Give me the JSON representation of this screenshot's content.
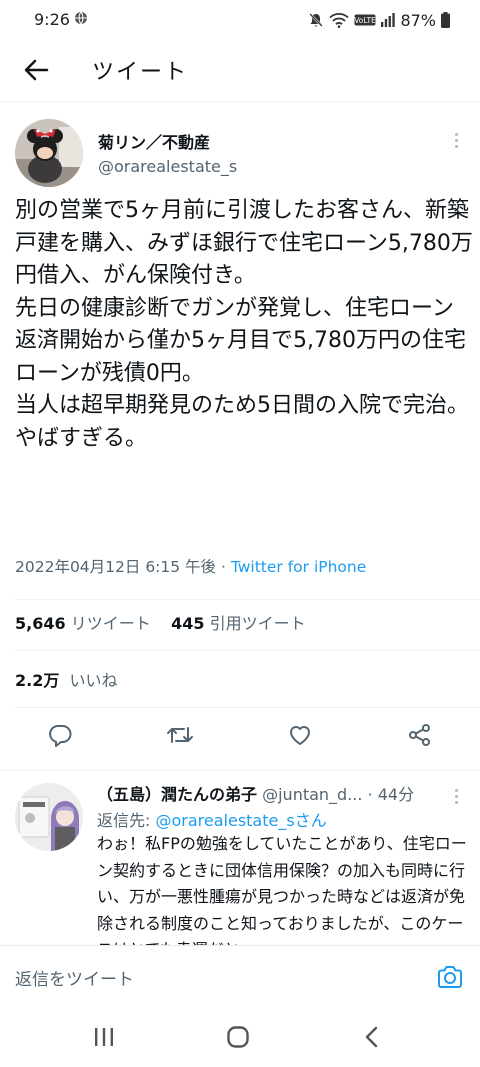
{
  "status_bar": {
    "time": "9:26",
    "battery": "87%"
  },
  "header": {
    "title": "ツイート"
  },
  "tweet": {
    "author_name": "菊リン／不動産",
    "author_handle": "@orarealestate_s",
    "text": "別の営業で5ヶ月前に引渡したお客さん、新築戸建を購入、みずほ銀行で住宅ローン5,780万円借入、がん保険付き。\n先日の健康診断でガンが発覚し、住宅ローン返済開始から僅か5ヶ月目で5,780万円の住宅ローンが残債0円。\n当人は超早期発見のため5日間の入院で完治。\nやばすぎる。",
    "timestamp": "2022年04月12日 6:15 午後",
    "separator": " · ",
    "source": "Twitter for iPhone",
    "retweets_count": "5,646",
    "retweets_label": "リツイート",
    "quotes_count": "445",
    "quotes_label": "引用ツイート",
    "likes_count": "2.2万",
    "likes_label": "いいね"
  },
  "reply": {
    "author_name": "（五島）潤たんの弟子",
    "author_handle": "@juntan_d...",
    "age": "· 44分",
    "replying_prefix": "返信先: ",
    "replying_handle": "@orarealestate_s",
    "replying_suffix": "さん",
    "text": "わぉ！私FPの勉強をしていたことがあり、住宅ローン契約するときに団体信用保険？の加入も同時に行い、万が一悪性腫瘍が見つかった時などは返済が免除される制度のこと知っておりましたが、このケースはとても幸運だと"
  },
  "compose": {
    "placeholder": "返信をツイート"
  },
  "colors": {
    "accent": "#1d9bf0",
    "text_primary": "#0f1419",
    "text_secondary": "#536471",
    "divider": "#eff3f4"
  },
  "icons": [
    "globe-icon",
    "mute-icon",
    "wifi-icon",
    "volte-icon",
    "signal-icon",
    "battery-icon",
    "back-arrow-icon",
    "more-vertical-icon",
    "reply-icon",
    "retweet-icon",
    "like-icon",
    "share-icon",
    "camera-icon",
    "recent-apps-icon",
    "home-icon",
    "back-icon"
  ]
}
